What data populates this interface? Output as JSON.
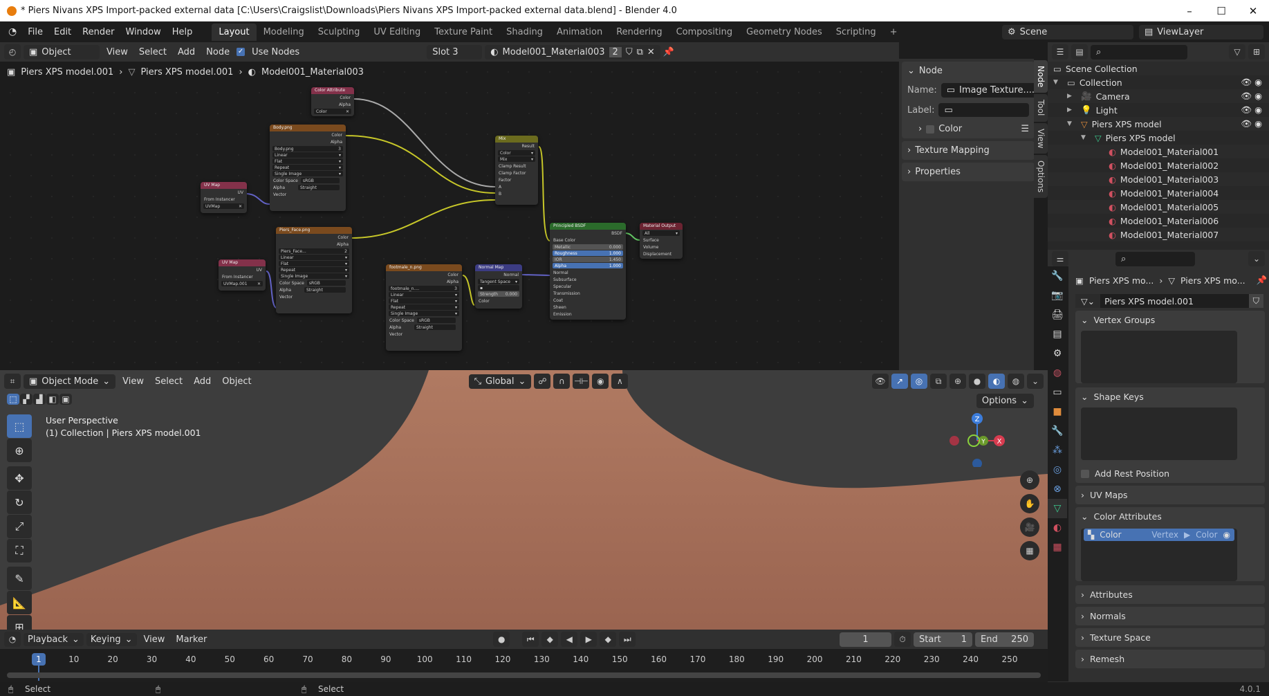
{
  "window": {
    "title": "* Piers Nivans XPS Import-packed external data [C:\\Users\\Craigslist\\Downloads\\Piers Nivans XPS Import-packed external data.blend] - Blender 4.0",
    "minimize": "–",
    "maximize": "☐",
    "close": "✕"
  },
  "menu": [
    "File",
    "Edit",
    "Render",
    "Window",
    "Help"
  ],
  "workspaces": [
    "Layout",
    "Modeling",
    "Sculpting",
    "UV Editing",
    "Texture Paint",
    "Shading",
    "Animation",
    "Rendering",
    "Compositing",
    "Geometry Nodes",
    "Scripting"
  ],
  "active_workspace": "Layout",
  "add_workspace": "+",
  "scene": {
    "label": "Scene"
  },
  "view_layer": {
    "label": "ViewLayer"
  },
  "node_editor": {
    "header": {
      "object_dropdown": "Object",
      "menus": [
        "View",
        "Select",
        "Add",
        "Node"
      ],
      "use_nodes_label": "Use Nodes",
      "use_nodes_checked": true,
      "slot": "Slot 3",
      "material": "Model001_Material003",
      "users": "2"
    },
    "breadcrumb": [
      "Piers XPS model.001",
      "Piers XPS model.001",
      "Model001_Material003"
    ],
    "nodes": {
      "color_attribute": {
        "title": "Color Attribute",
        "outputs": [
          "Color",
          "Alpha"
        ],
        "field": "Color"
      },
      "body": {
        "title": "Body.png",
        "outputs": [
          "Color",
          "Alpha"
        ],
        "image": "Body.png",
        "users": "3",
        "interp": "Linear",
        "proj": "Flat",
        "ext": "Repeat",
        "source": "Single Image",
        "color_space_label": "Color Space",
        "color_space": "sRGB",
        "alpha_label": "Alpha",
        "alpha": "Straight",
        "input": "Vector"
      },
      "uvmap1": {
        "title": "UV Map",
        "output": "UV",
        "from_instancer": "From Instancer",
        "map": "UVMap"
      },
      "face": {
        "title": "Piers_Face.png",
        "outputs": [
          "Color",
          "Alpha"
        ],
        "image": "Piers_Face...",
        "users": "2",
        "interp": "Linear",
        "proj": "Flat",
        "ext": "Repeat",
        "source": "Single Image",
        "color_space_label": "Color Space",
        "color_space": "sRGB",
        "alpha_label": "Alpha",
        "alpha": "Straight",
        "input": "Vector"
      },
      "uvmap2": {
        "title": "UV Map",
        "output": "UV",
        "from_instancer": "From Instancer",
        "map": "UVMap.001"
      },
      "footmale": {
        "title": "footmale_n.png",
        "outputs": [
          "Color",
          "Alpha"
        ],
        "image": "footmale_n....",
        "users": "3",
        "interp": "Linear",
        "proj": "Flat",
        "ext": "Repeat",
        "source": "Single Image",
        "color_space_label": "Color Space",
        "color_space": "sRGB",
        "alpha_label": "Alpha",
        "alpha": "Straight",
        "input": "Vector"
      },
      "normal_map": {
        "title": "Normal Map",
        "output": "Normal",
        "space": "Tangent Space",
        "strength_label": "Strength",
        "strength": "0.000",
        "input": "Color"
      },
      "mix": {
        "title": "Mix",
        "output": "Result",
        "type": "Color",
        "blend": "Mix",
        "clamp_result": "Clamp Result",
        "clamp_factor": "Clamp Factor",
        "inputs": [
          "Factor",
          "A",
          "B"
        ]
      },
      "bsdf": {
        "title": "Principled BSDF",
        "output": "BSDF",
        "base_color": "Base Color",
        "fields": [
          {
            "label": "Metallic",
            "value": "0.000",
            "style": "gray"
          },
          {
            "label": "Roughness",
            "value": "1.000",
            "style": "blue"
          },
          {
            "label": "IOR",
            "value": "1.450",
            "style": "gray"
          },
          {
            "label": "Alpha",
            "value": "1.000",
            "style": "blue"
          }
        ],
        "normal": "Normal",
        "sections": [
          "Subsurface",
          "Specular",
          "Transmission",
          "Coat",
          "Sheen",
          "Emission"
        ]
      },
      "output": {
        "title": "Material Output",
        "target": "All",
        "inputs": [
          "Surface",
          "Volume",
          "Displacement"
        ]
      }
    },
    "sidebar": {
      "node_panel": "Node",
      "name_label": "Name:",
      "name_value": "Image Texture....",
      "label_label": "Label:",
      "color": "Color",
      "texture_mapping": "Texture Mapping",
      "properties": "Properties"
    },
    "tabs": [
      "Node",
      "Tool",
      "View",
      "Options"
    ]
  },
  "outliner": {
    "scene_collection": "Scene Collection",
    "items": [
      {
        "label": "Collection",
        "depth": 0,
        "icon": "collection"
      },
      {
        "label": "Camera",
        "depth": 1,
        "icon": "camera"
      },
      {
        "label": "Light",
        "depth": 1,
        "icon": "light"
      },
      {
        "label": "Piers XPS model",
        "depth": 1,
        "icon": "mesh-object"
      },
      {
        "label": "Piers XPS model",
        "depth": 2,
        "icon": "mesh-data"
      },
      {
        "label": "Model001_Material001",
        "depth": 3,
        "icon": "material"
      },
      {
        "label": "Model001_Material002",
        "depth": 3,
        "icon": "material"
      },
      {
        "label": "Model001_Material003",
        "depth": 3,
        "icon": "material"
      },
      {
        "label": "Model001_Material004",
        "depth": 3,
        "icon": "material"
      },
      {
        "label": "Model001_Material005",
        "depth": 3,
        "icon": "material"
      },
      {
        "label": "Model001_Material006",
        "depth": 3,
        "icon": "material"
      },
      {
        "label": "Model001_Material007",
        "depth": 3,
        "icon": "material"
      }
    ]
  },
  "properties": {
    "breadcrumb": [
      "Piers XPS mo...",
      "Piers XPS mo..."
    ],
    "mesh_name": "Piers XPS model.001",
    "panels": {
      "vertex_groups": "Vertex Groups",
      "shape_keys": "Shape Keys",
      "add_rest_position": "Add Rest Position",
      "uv_maps": "UV Maps",
      "color_attributes": "Color Attributes",
      "color_attr_item": {
        "name": "Color",
        "domain": "Vertex",
        "type": "Color"
      },
      "attributes": "Attributes",
      "normals": "Normals",
      "texture_space": "Texture Space",
      "remesh": "Remesh"
    }
  },
  "viewport": {
    "mode": "Object Mode",
    "menus": [
      "View",
      "Select",
      "Add",
      "Object"
    ],
    "orientation": "Global",
    "overlay_text": [
      "User Perspective",
      "(1) Collection | Piers XPS model.001"
    ],
    "options": "Options",
    "gizmo": {
      "z": "Z",
      "x": "X",
      "y": "Y"
    }
  },
  "timeline": {
    "menus": [
      "Playback",
      "Keying",
      "View",
      "Marker"
    ],
    "current_frame": "1",
    "start_label": "Start",
    "start": "1",
    "end_label": "End",
    "end": "250",
    "ticks": [
      "10",
      "20",
      "30",
      "40",
      "50",
      "60",
      "70",
      "80",
      "90",
      "100",
      "110",
      "120",
      "130",
      "140",
      "150",
      "160",
      "170",
      "180",
      "190",
      "200",
      "210",
      "220",
      "230",
      "240",
      "250"
    ]
  },
  "status": {
    "left": "Select",
    "right": "Select",
    "version": "4.0.1"
  }
}
